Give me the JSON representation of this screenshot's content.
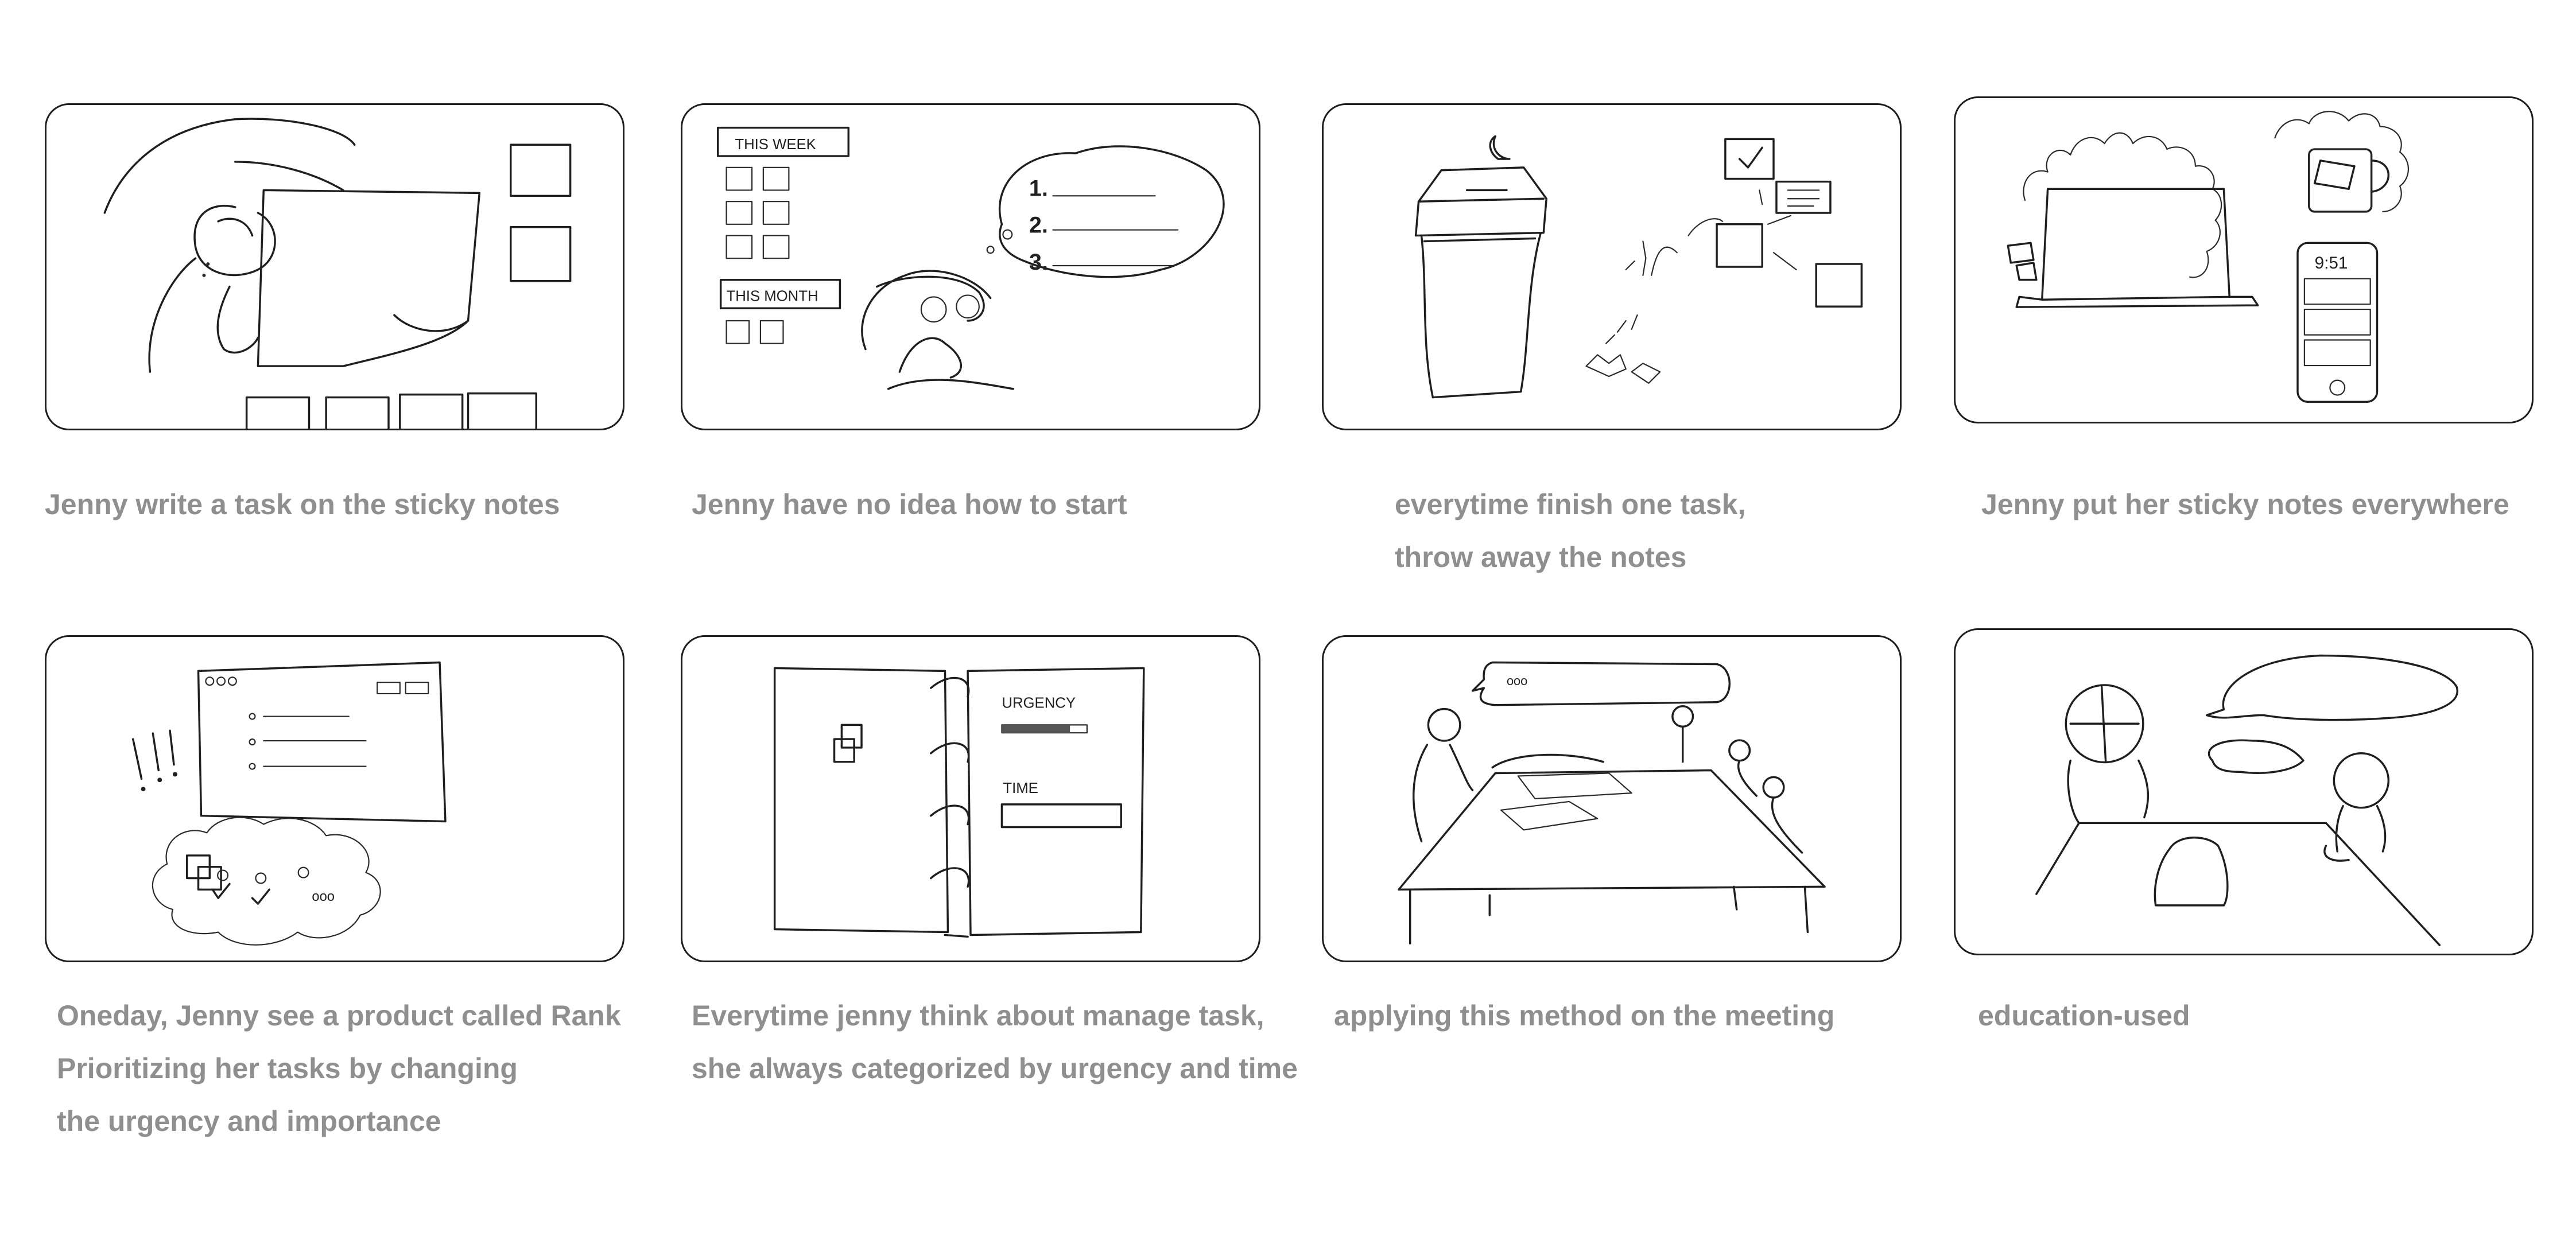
{
  "storyboard": {
    "panels": [
      {
        "id": "p1",
        "caption": [
          "Jenny write a task on the sticky notes"
        ]
      },
      {
        "id": "p2",
        "caption": [
          "Jenny have no idea how to start"
        ],
        "sketch_text": {
          "week": "THIS WEEK",
          "month": "THIS MONTH",
          "n1": "1.",
          "n2": "2.",
          "n3": "3."
        }
      },
      {
        "id": "p3",
        "caption": [
          "everytime finish one task,",
          "throw away the notes"
        ]
      },
      {
        "id": "p4",
        "caption": [
          "Jenny put her sticky notes everywhere"
        ],
        "sketch_text": {
          "clock": "9:51"
        }
      },
      {
        "id": "p5",
        "caption": [
          "Oneday, Jenny see a product called Rank",
          "Prioritizing her tasks by changing",
          "the urgency and importance"
        ],
        "sketch_text": {
          "dots": "ooo",
          "ellipsis": "ooo"
        }
      },
      {
        "id": "p6",
        "caption": [
          "Everytime jenny think about manage task,",
          "she always categorized by urgency and time"
        ],
        "sketch_text": {
          "urgency": "URGENCY",
          "time": "TIME"
        }
      },
      {
        "id": "p7",
        "caption": [
          "applying this method on the meeting"
        ],
        "sketch_text": {
          "bubble": "ooo"
        }
      },
      {
        "id": "p8",
        "caption": [
          "education-used"
        ]
      }
    ]
  }
}
